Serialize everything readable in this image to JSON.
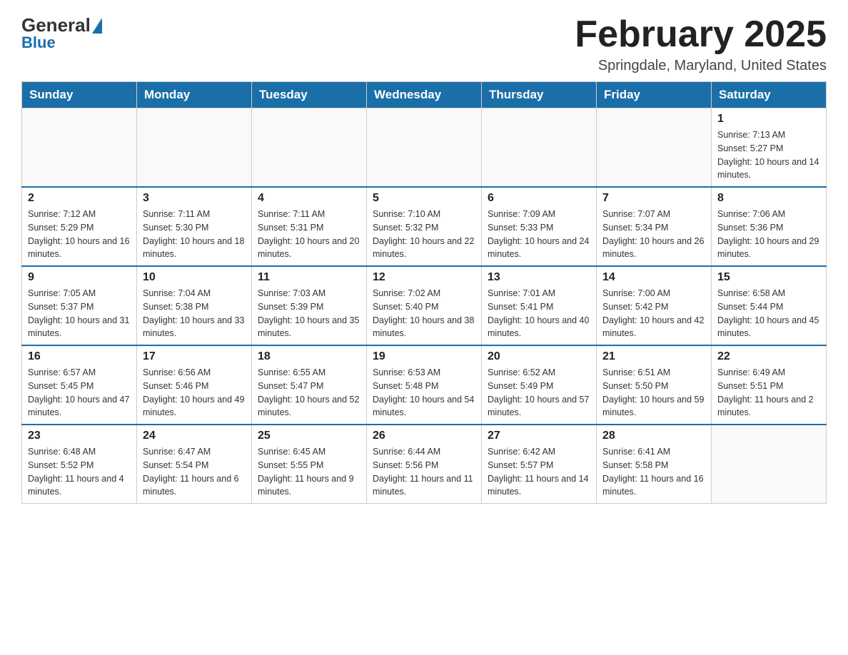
{
  "header": {
    "logo_general": "General",
    "logo_blue": "Blue",
    "title": "February 2025",
    "subtitle": "Springdale, Maryland, United States"
  },
  "days_of_week": [
    "Sunday",
    "Monday",
    "Tuesday",
    "Wednesday",
    "Thursday",
    "Friday",
    "Saturday"
  ],
  "weeks": [
    {
      "days": [
        {
          "date": "",
          "info": ""
        },
        {
          "date": "",
          "info": ""
        },
        {
          "date": "",
          "info": ""
        },
        {
          "date": "",
          "info": ""
        },
        {
          "date": "",
          "info": ""
        },
        {
          "date": "",
          "info": ""
        },
        {
          "date": "1",
          "info": "Sunrise: 7:13 AM\nSunset: 5:27 PM\nDaylight: 10 hours and 14 minutes."
        }
      ]
    },
    {
      "days": [
        {
          "date": "2",
          "info": "Sunrise: 7:12 AM\nSunset: 5:29 PM\nDaylight: 10 hours and 16 minutes."
        },
        {
          "date": "3",
          "info": "Sunrise: 7:11 AM\nSunset: 5:30 PM\nDaylight: 10 hours and 18 minutes."
        },
        {
          "date": "4",
          "info": "Sunrise: 7:11 AM\nSunset: 5:31 PM\nDaylight: 10 hours and 20 minutes."
        },
        {
          "date": "5",
          "info": "Sunrise: 7:10 AM\nSunset: 5:32 PM\nDaylight: 10 hours and 22 minutes."
        },
        {
          "date": "6",
          "info": "Sunrise: 7:09 AM\nSunset: 5:33 PM\nDaylight: 10 hours and 24 minutes."
        },
        {
          "date": "7",
          "info": "Sunrise: 7:07 AM\nSunset: 5:34 PM\nDaylight: 10 hours and 26 minutes."
        },
        {
          "date": "8",
          "info": "Sunrise: 7:06 AM\nSunset: 5:36 PM\nDaylight: 10 hours and 29 minutes."
        }
      ]
    },
    {
      "days": [
        {
          "date": "9",
          "info": "Sunrise: 7:05 AM\nSunset: 5:37 PM\nDaylight: 10 hours and 31 minutes."
        },
        {
          "date": "10",
          "info": "Sunrise: 7:04 AM\nSunset: 5:38 PM\nDaylight: 10 hours and 33 minutes."
        },
        {
          "date": "11",
          "info": "Sunrise: 7:03 AM\nSunset: 5:39 PM\nDaylight: 10 hours and 35 minutes."
        },
        {
          "date": "12",
          "info": "Sunrise: 7:02 AM\nSunset: 5:40 PM\nDaylight: 10 hours and 38 minutes."
        },
        {
          "date": "13",
          "info": "Sunrise: 7:01 AM\nSunset: 5:41 PM\nDaylight: 10 hours and 40 minutes."
        },
        {
          "date": "14",
          "info": "Sunrise: 7:00 AM\nSunset: 5:42 PM\nDaylight: 10 hours and 42 minutes."
        },
        {
          "date": "15",
          "info": "Sunrise: 6:58 AM\nSunset: 5:44 PM\nDaylight: 10 hours and 45 minutes."
        }
      ]
    },
    {
      "days": [
        {
          "date": "16",
          "info": "Sunrise: 6:57 AM\nSunset: 5:45 PM\nDaylight: 10 hours and 47 minutes."
        },
        {
          "date": "17",
          "info": "Sunrise: 6:56 AM\nSunset: 5:46 PM\nDaylight: 10 hours and 49 minutes."
        },
        {
          "date": "18",
          "info": "Sunrise: 6:55 AM\nSunset: 5:47 PM\nDaylight: 10 hours and 52 minutes."
        },
        {
          "date": "19",
          "info": "Sunrise: 6:53 AM\nSunset: 5:48 PM\nDaylight: 10 hours and 54 minutes."
        },
        {
          "date": "20",
          "info": "Sunrise: 6:52 AM\nSunset: 5:49 PM\nDaylight: 10 hours and 57 minutes."
        },
        {
          "date": "21",
          "info": "Sunrise: 6:51 AM\nSunset: 5:50 PM\nDaylight: 10 hours and 59 minutes."
        },
        {
          "date": "22",
          "info": "Sunrise: 6:49 AM\nSunset: 5:51 PM\nDaylight: 11 hours and 2 minutes."
        }
      ]
    },
    {
      "days": [
        {
          "date": "23",
          "info": "Sunrise: 6:48 AM\nSunset: 5:52 PM\nDaylight: 11 hours and 4 minutes."
        },
        {
          "date": "24",
          "info": "Sunrise: 6:47 AM\nSunset: 5:54 PM\nDaylight: 11 hours and 6 minutes."
        },
        {
          "date": "25",
          "info": "Sunrise: 6:45 AM\nSunset: 5:55 PM\nDaylight: 11 hours and 9 minutes."
        },
        {
          "date": "26",
          "info": "Sunrise: 6:44 AM\nSunset: 5:56 PM\nDaylight: 11 hours and 11 minutes."
        },
        {
          "date": "27",
          "info": "Sunrise: 6:42 AM\nSunset: 5:57 PM\nDaylight: 11 hours and 14 minutes."
        },
        {
          "date": "28",
          "info": "Sunrise: 6:41 AM\nSunset: 5:58 PM\nDaylight: 11 hours and 16 minutes."
        },
        {
          "date": "",
          "info": ""
        }
      ]
    }
  ]
}
